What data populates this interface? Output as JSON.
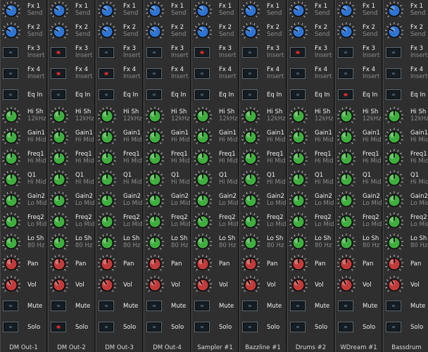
{
  "window": {
    "title": ""
  },
  "rows": [
    {
      "id": "fx1",
      "type": "knob",
      "color": "blue",
      "label": "Fx 1",
      "sub": "Send"
    },
    {
      "id": "fx2",
      "type": "knob",
      "color": "blue",
      "label": "Fx 2",
      "sub": "Send"
    },
    {
      "id": "fx3",
      "type": "toggle",
      "label": "Fx 3",
      "sub": "Insert"
    },
    {
      "id": "fx4",
      "type": "toggle",
      "label": "Fx 4",
      "sub": "Insert"
    },
    {
      "id": "eqin",
      "type": "toggle",
      "label": "Eq In",
      "sub": ""
    },
    {
      "id": "hish",
      "type": "knob",
      "color": "green",
      "label": "Hi Sh",
      "sub": "12kHz"
    },
    {
      "id": "gain1",
      "type": "knob",
      "color": "green",
      "label": "Gain1",
      "sub": "Hi Mid"
    },
    {
      "id": "freq1",
      "type": "knob",
      "color": "green",
      "label": "Freq1",
      "sub": "Hi Mid"
    },
    {
      "id": "q1",
      "type": "knob",
      "color": "green",
      "label": "Q1",
      "sub": "Hi Mid"
    },
    {
      "id": "gain2",
      "type": "knob",
      "color": "green",
      "label": "Gain2",
      "sub": "Lo Mid"
    },
    {
      "id": "freq2",
      "type": "knob",
      "color": "green",
      "label": "Freq2",
      "sub": "Lo Mid"
    },
    {
      "id": "losh",
      "type": "knob",
      "color": "green",
      "label": "Lo Sh",
      "sub": "80 Hz"
    },
    {
      "id": "pan",
      "type": "knob",
      "color": "red",
      "label": "Pan",
      "sub": ""
    },
    {
      "id": "vol",
      "type": "knob",
      "color": "red",
      "label": "Vol",
      "sub": ""
    },
    {
      "id": "mute",
      "type": "toggle",
      "label": "Mute",
      "sub": ""
    },
    {
      "id": "solo",
      "type": "toggle",
      "label": "Solo",
      "sub": ""
    }
  ],
  "channels": [
    {
      "name": "DM Out-1",
      "toggles": {
        "fx3": false,
        "fx4": false,
        "eqin": false,
        "mute": false,
        "solo": false
      }
    },
    {
      "name": "DM Out-2",
      "toggles": {
        "fx3": true,
        "fx4": true,
        "eqin": false,
        "mute": false,
        "solo": true
      }
    },
    {
      "name": "DM Out-3",
      "toggles": {
        "fx3": false,
        "fx4": true,
        "eqin": false,
        "mute": false,
        "solo": false
      }
    },
    {
      "name": "DM Out-4",
      "toggles": {
        "fx3": false,
        "fx4": false,
        "eqin": false,
        "mute": false,
        "solo": false
      }
    },
    {
      "name": "Sampler #1",
      "toggles": {
        "fx3": true,
        "fx4": false,
        "eqin": false,
        "mute": false,
        "solo": false
      }
    },
    {
      "name": "Bazzline #1",
      "toggles": {
        "fx3": false,
        "fx4": false,
        "eqin": false,
        "mute": false,
        "solo": false
      }
    },
    {
      "name": "Drums #2",
      "toggles": {
        "fx3": true,
        "fx4": false,
        "eqin": false,
        "mute": false,
        "solo": false
      }
    },
    {
      "name": "WDream #1",
      "toggles": {
        "fx3": false,
        "fx4": false,
        "eqin": true,
        "mute": false,
        "solo": false
      }
    },
    {
      "name": "Bassdrum",
      "toggles": {
        "fx3": false,
        "fx4": false,
        "eqin": false,
        "mute": false,
        "solo": false
      }
    }
  ],
  "knob_colors": {
    "blue": "#2f74d0",
    "green": "#3fae3f",
    "red": "#c23b3b"
  }
}
